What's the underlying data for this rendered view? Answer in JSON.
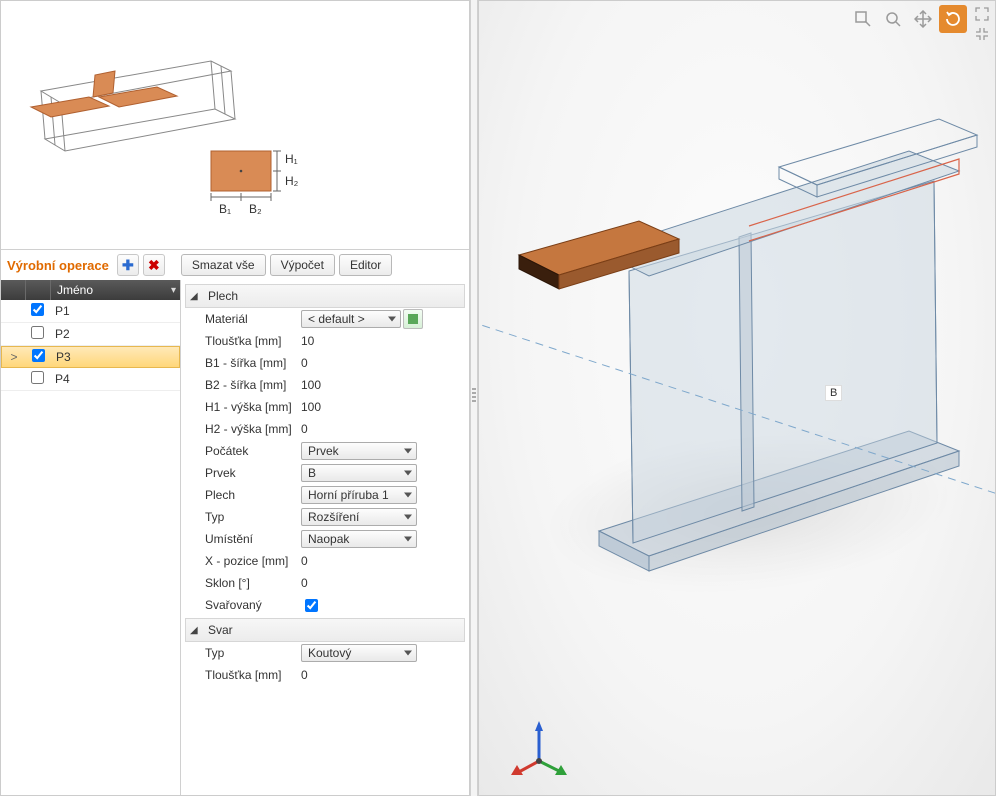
{
  "ops_title": "Výrobní operace",
  "buttons": {
    "delete_all": "Smazat vše",
    "calculate": "Výpočet",
    "editor": "Editor"
  },
  "list": {
    "header": "Jméno",
    "rows": [
      {
        "name": "P1",
        "checked": true,
        "selected": false,
        "active": false
      },
      {
        "name": "P2",
        "checked": false,
        "selected": false,
        "active": false
      },
      {
        "name": "P3",
        "checked": true,
        "selected": true,
        "active": true
      },
      {
        "name": "P4",
        "checked": false,
        "selected": false,
        "active": false
      }
    ]
  },
  "groups": {
    "plate": "Plech",
    "weld": "Svar"
  },
  "props": {
    "material_label": "Materiál",
    "material_value": "< default >",
    "thickness_label": "Tloušťka [mm]",
    "thickness_value": "10",
    "b1_label": "B1 - šířka [mm]",
    "b1_value": "0",
    "b2_label": "B2 - šířka [mm]",
    "b2_value": "100",
    "h1_label": "H1 - výška [mm]",
    "h1_value": "100",
    "h2_label": "H2 - výška [mm]",
    "h2_value": "0",
    "origin_label": "Počátek",
    "origin_value": "Prvek",
    "member_label": "Prvek",
    "member_value": "B",
    "plate_label": "Plech",
    "plate_value": "Horní příruba 1",
    "type_label": "Typ",
    "type_value": "Rozšíření",
    "location_label": "Umístění",
    "location_value": "Naopak",
    "x_label": "X - pozice [mm]",
    "x_value": "0",
    "slope_label": "Sklon [°]",
    "slope_value": "0",
    "welded_label": "Svařovaný",
    "weld_type_label": "Typ",
    "weld_type_value": "Koutový",
    "weld_thk_label": "Tloušťka [mm]",
    "weld_thk_value": "0"
  },
  "diagram": {
    "H1": "H₁",
    "H2": "H₂",
    "B1": "B₁",
    "B2": "B₂"
  },
  "viewport": {
    "label_b": "B"
  }
}
